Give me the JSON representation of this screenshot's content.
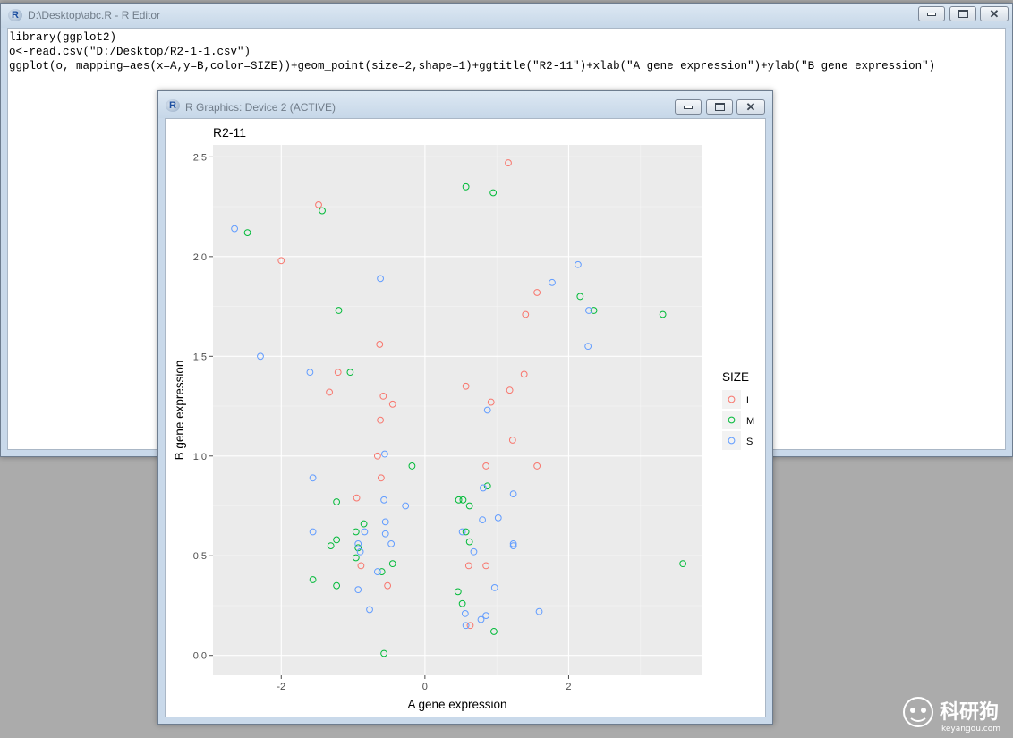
{
  "editor": {
    "title": "D:\\Desktop\\abc.R - R Editor",
    "lines": [
      "library(ggplot2)",
      "o<-read.csv(\"D:/Desktop/R2-1-1.csv\")",
      "ggplot(o, mapping=aes(x=A,y=B,color=SIZE))+geom_point(size=2,shape=1)+ggtitle(\"R2-11\")+xlab(\"A gene expression\")+ylab(\"B gene expression\")"
    ]
  },
  "graphics": {
    "title": "R Graphics: Device 2 (ACTIVE)"
  },
  "window_icons": {
    "minimize": "minimize-icon",
    "maximize": "maximize-icon",
    "close": "close-icon"
  },
  "watermark": {
    "brand": "科研狗",
    "site": "keyangou.com"
  },
  "chart_data": {
    "type": "scatter",
    "title": "R2-11",
    "xlabel": "A gene expression",
    "ylabel": "B gene expression",
    "xlim": [
      -2.95,
      3.85
    ],
    "ylim": [
      -0.1,
      2.56
    ],
    "xticks": [
      -2,
      0,
      2
    ],
    "xtick_labels": [
      "-2",
      "0",
      "2"
    ],
    "yticks": [
      0.0,
      0.5,
      1.0,
      1.5,
      2.0,
      2.5
    ],
    "ytick_labels": [
      "0.0",
      "0.5",
      "1.0",
      "1.5",
      "2.0",
      "2.5"
    ],
    "grid": true,
    "background": "#ebebeb",
    "legend": {
      "title": "SIZE",
      "position": "right"
    },
    "series": [
      {
        "name": "L",
        "color": "#f8766d",
        "points": [
          [
            1.16,
            2.47
          ],
          [
            -1.48,
            2.26
          ],
          [
            -2.0,
            1.98
          ],
          [
            1.56,
            1.82
          ],
          [
            1.4,
            1.71
          ],
          [
            -0.63,
            1.56
          ],
          [
            1.38,
            1.41
          ],
          [
            -1.21,
            1.42
          ],
          [
            -1.33,
            1.32
          ],
          [
            0.57,
            1.35
          ],
          [
            1.18,
            1.33
          ],
          [
            -0.58,
            1.3
          ],
          [
            0.92,
            1.27
          ],
          [
            -0.45,
            1.26
          ],
          [
            -0.62,
            1.18
          ],
          [
            1.22,
            1.08
          ],
          [
            -0.66,
            1.0
          ],
          [
            0.85,
            0.95
          ],
          [
            1.56,
            0.95
          ],
          [
            -0.61,
            0.89
          ],
          [
            -0.95,
            0.79
          ],
          [
            0.61,
            0.45
          ],
          [
            0.85,
            0.45
          ],
          [
            -0.89,
            0.45
          ],
          [
            -0.52,
            0.35
          ],
          [
            0.63,
            0.15
          ]
        ]
      },
      {
        "name": "M",
        "color": "#00ba38",
        "points": [
          [
            0.57,
            2.35
          ],
          [
            0.95,
            2.32
          ],
          [
            -1.43,
            2.23
          ],
          [
            -2.47,
            2.12
          ],
          [
            -1.2,
            1.73
          ],
          [
            2.16,
            1.8
          ],
          [
            2.35,
            1.73
          ],
          [
            3.31,
            1.71
          ],
          [
            -1.04,
            1.42
          ],
          [
            -0.18,
            0.95
          ],
          [
            0.87,
            0.85
          ],
          [
            0.47,
            0.78
          ],
          [
            0.53,
            0.78
          ],
          [
            0.62,
            0.75
          ],
          [
            -1.23,
            0.77
          ],
          [
            -0.85,
            0.66
          ],
          [
            -0.96,
            0.62
          ],
          [
            0.57,
            0.62
          ],
          [
            -1.23,
            0.58
          ],
          [
            0.62,
            0.57
          ],
          [
            -1.31,
            0.55
          ],
          [
            -0.93,
            0.54
          ],
          [
            -0.6,
            0.42
          ],
          [
            -0.45,
            0.46
          ],
          [
            -0.96,
            0.49
          ],
          [
            3.59,
            0.46
          ],
          [
            -1.56,
            0.38
          ],
          [
            -1.23,
            0.35
          ],
          [
            0.46,
            0.32
          ],
          [
            0.52,
            0.26
          ],
          [
            0.96,
            0.12
          ],
          [
            -0.57,
            0.01
          ]
        ]
      },
      {
        "name": "S",
        "color": "#619cff",
        "points": [
          [
            -2.65,
            2.14
          ],
          [
            -0.62,
            1.89
          ],
          [
            2.13,
            1.96
          ],
          [
            1.77,
            1.87
          ],
          [
            2.28,
            1.73
          ],
          [
            2.27,
            1.55
          ],
          [
            -2.29,
            1.5
          ],
          [
            -1.6,
            1.42
          ],
          [
            0.87,
            1.23
          ],
          [
            -0.56,
            1.01
          ],
          [
            -1.56,
            0.89
          ],
          [
            0.81,
            0.84
          ],
          [
            1.23,
            0.81
          ],
          [
            -0.57,
            0.78
          ],
          [
            -0.27,
            0.75
          ],
          [
            1.02,
            0.69
          ],
          [
            -0.55,
            0.67
          ],
          [
            0.8,
            0.68
          ],
          [
            -1.56,
            0.62
          ],
          [
            -0.84,
            0.62
          ],
          [
            0.52,
            0.62
          ],
          [
            -0.55,
            0.61
          ],
          [
            -0.47,
            0.56
          ],
          [
            -0.93,
            0.56
          ],
          [
            1.23,
            0.56
          ],
          [
            1.23,
            0.55
          ],
          [
            -0.9,
            0.52
          ],
          [
            0.68,
            0.52
          ],
          [
            -0.66,
            0.42
          ],
          [
            -0.93,
            0.33
          ],
          [
            0.97,
            0.34
          ],
          [
            -0.77,
            0.23
          ],
          [
            1.59,
            0.22
          ],
          [
            0.56,
            0.21
          ],
          [
            0.78,
            0.18
          ],
          [
            0.85,
            0.2
          ],
          [
            0.57,
            0.15
          ]
        ]
      }
    ]
  }
}
